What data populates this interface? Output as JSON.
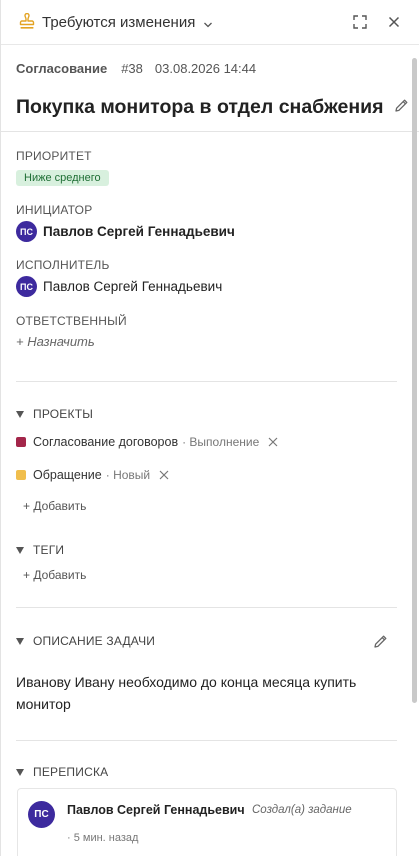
{
  "header": {
    "status_label": "Требуются изменения",
    "status_icon": "stamp-icon",
    "expand_icon": "expand-icon",
    "close_icon": "close-icon"
  },
  "meta": {
    "type": "Согласование",
    "number": "#38",
    "datetime": "03.08.2026 14:44"
  },
  "title": "Покупка монитора в отдел снабжения",
  "fields": {
    "priority_label": "ПРИОРИТЕТ",
    "priority_value": "Ниже среднего",
    "initiator_label": "ИНИЦИАТОР",
    "initiator": {
      "initials": "ПС",
      "name": "Павлов Сергей Геннадьевич"
    },
    "executor_label": "ИСПОЛНИТЕЛЬ",
    "executor": {
      "initials": "ПС",
      "name": "Павлов Сергей Геннадьевич"
    },
    "responsible_label": "ОТВЕТСТВЕННЫЙ",
    "assign_link": "+ Назначить"
  },
  "projects": {
    "heading": "ПРОЕКТЫ",
    "items": [
      {
        "name": "Согласование договоров",
        "state": "· Выполнение",
        "color": "#a3264a"
      },
      {
        "name": "Обращение",
        "state": "· Новый",
        "color": "#f0be4d"
      }
    ],
    "add_label": "+ Добавить"
  },
  "tags": {
    "heading": "ТЕГИ",
    "add_label": "+ Добавить"
  },
  "description": {
    "heading": "ОПИСАНИЕ ЗАДАЧИ",
    "text": "Иванову Ивану необходимо до конца месяца купить монитор"
  },
  "correspondence": {
    "heading": "ПЕРЕПИСКА",
    "comment": {
      "initials": "ПС",
      "author": "Павлов Сергей Геннадьевич",
      "action": "Создал(а) задание",
      "time": "· 5 мин. назад"
    }
  },
  "colors": {
    "avatar": "#3d2a9e",
    "priority_bg": "#d8f0de",
    "priority_text": "#1e6e34",
    "stamp": "#e3a323"
  }
}
